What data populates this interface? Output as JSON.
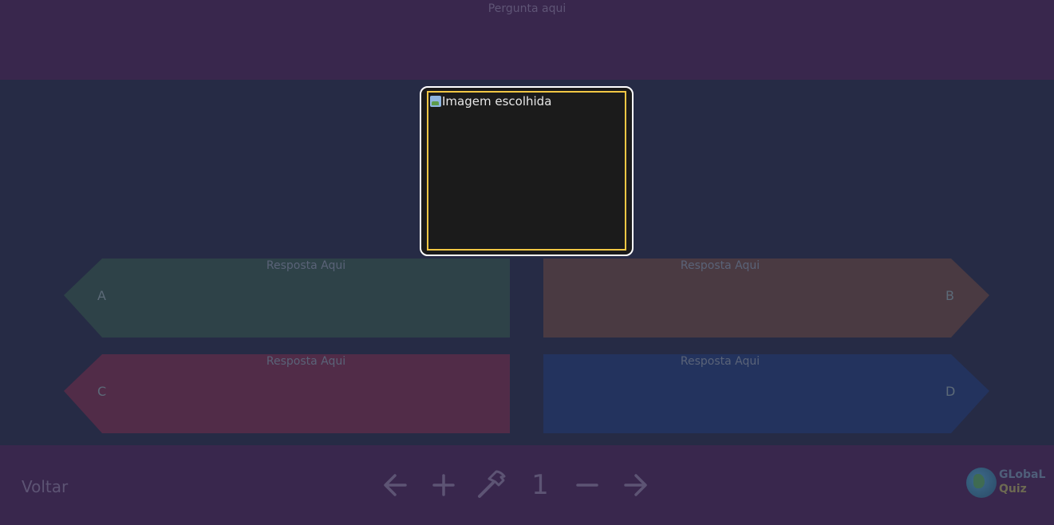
{
  "header": {
    "question": "Pergunta aqui"
  },
  "media": {
    "image_alt": "Imagem escolhida"
  },
  "answers": [
    {
      "letter": "A",
      "text": "Resposta Aqui",
      "color": "#2e4248"
    },
    {
      "letter": "B",
      "text": "Resposta Aqui",
      "color": "#4a3a42"
    },
    {
      "letter": "C",
      "text": "Resposta Aqui",
      "color": "#512c48"
    },
    {
      "letter": "D",
      "text": "Resposta Aqui",
      "color": "#23335e"
    }
  ],
  "footer": {
    "back_label": "Voltar",
    "page_number": "1",
    "controls": [
      "arrow-left-icon",
      "plus-icon",
      "hammer-icon",
      "minus-icon",
      "arrow-right-icon"
    ]
  },
  "logo": {
    "line1": "GLobaL",
    "line2": "Quiz"
  },
  "colors": {
    "top_bar": "#39274d",
    "main_bg": "#262b45",
    "image_border": "#f2c744",
    "muted_text": "#5d5474"
  }
}
